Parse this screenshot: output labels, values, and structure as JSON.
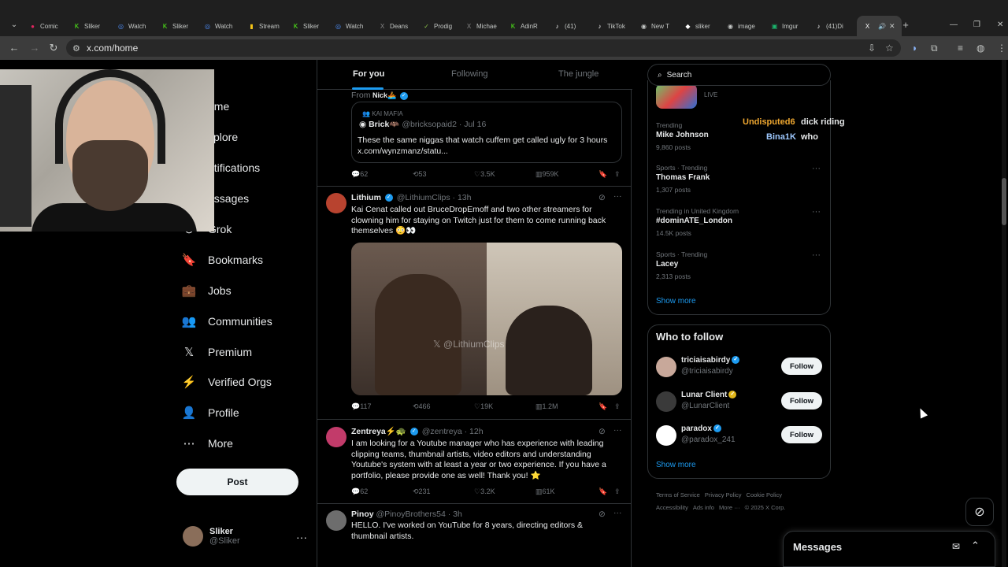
{
  "browser": {
    "tabs": [
      {
        "label": "Comic",
        "color": "#e0245e",
        "glyph": "●"
      },
      {
        "label": "Sliker",
        "color": "#53fc18",
        "glyph": "K"
      },
      {
        "label": "Watch",
        "color": "#4c8bf5",
        "glyph": "◎"
      },
      {
        "label": "Sliker",
        "color": "#53fc18",
        "glyph": "K"
      },
      {
        "label": "Watch",
        "color": "#4c8bf5",
        "glyph": "◎"
      },
      {
        "label": "Stream",
        "color": "#f5c518",
        "glyph": "▮"
      },
      {
        "label": "Sliker",
        "color": "#53fc18",
        "glyph": "K"
      },
      {
        "label": "Watch",
        "color": "#4c8bf5",
        "glyph": "◎"
      },
      {
        "label": "Deans",
        "color": "#888888",
        "glyph": "X"
      },
      {
        "label": "Prodig",
        "color": "#8bc34a",
        "glyph": "✓"
      },
      {
        "label": "Michae",
        "color": "#888888",
        "glyph": "X"
      },
      {
        "label": "AdinR",
        "color": "#53fc18",
        "glyph": "K"
      },
      {
        "label": "(41)",
        "color": "#ffffff",
        "glyph": "♪"
      },
      {
        "label": "TikTok",
        "color": "#ffffff",
        "glyph": "♪"
      },
      {
        "label": "New T",
        "color": "#c4c7c5",
        "glyph": "◉"
      },
      {
        "label": "sliker",
        "color": "#ffffff",
        "glyph": "◆"
      },
      {
        "label": "image",
        "color": "#c4c7c5",
        "glyph": "◉"
      },
      {
        "label": "Imgur",
        "color": "#1bb76e",
        "glyph": "▣"
      },
      {
        "label": "(41)Di",
        "color": "#ffffff",
        "glyph": "♪"
      },
      {
        "label": "",
        "color": "#ffffff",
        "glyph": "X"
      }
    ],
    "url": "x.com/home"
  },
  "nav": {
    "items": [
      {
        "label": "ome",
        "icon": "home-icon",
        "glyph": "⌂"
      },
      {
        "label": "xplore",
        "icon": "search-icon",
        "glyph": "⌕"
      },
      {
        "label": "otifications",
        "icon": "bell-icon",
        "glyph": "🔔"
      },
      {
        "label": "essages",
        "icon": "mail-icon",
        "glyph": "✉"
      },
      {
        "label": "Grok",
        "icon": "grok-icon",
        "glyph": "⊘"
      },
      {
        "label": "Bookmarks",
        "icon": "bookmark-icon",
        "glyph": "🔖"
      },
      {
        "label": "Jobs",
        "icon": "briefcase-icon",
        "glyph": "💼"
      },
      {
        "label": "Communities",
        "icon": "people-icon",
        "glyph": "👥"
      },
      {
        "label": "Premium",
        "icon": "x-logo-icon",
        "glyph": "𝕏"
      },
      {
        "label": "Verified Orgs",
        "icon": "lightning-icon",
        "glyph": "⚡"
      },
      {
        "label": "Profile",
        "icon": "person-icon",
        "glyph": "👤"
      },
      {
        "label": "More",
        "icon": "more-circle-icon",
        "glyph": "⋯"
      }
    ],
    "post_label": "Post",
    "account": {
      "name": "Sliker",
      "handle": "@Sliker"
    }
  },
  "feed": {
    "tabs": [
      "For you",
      "Following",
      "The jungle"
    ],
    "tweet1": {
      "from_label": "From",
      "from_name": "Nick🚣",
      "quote_context": "KAI MAFIA",
      "quote_name": "Brick🦇",
      "quote_handle": "@bricksopaid2 · Jul 16",
      "quote_text": "These the same niggas that watch cuffem get called ugly for 3 hours x.com/wynzmanz/statu...",
      "stats": {
        "replies": "62",
        "reposts": "53",
        "likes": "3.5K",
        "views": "959K"
      }
    },
    "tweet2": {
      "name": "Lithium",
      "handle": "@LithiumClips · 13h",
      "text": "Kai Cenat called out BruceDropEmoff and two other streamers for clowning him for staying on Twitch just for them to come running back themselves 😳👀",
      "watermark": "@LithiumClips",
      "stats": {
        "replies": "117",
        "reposts": "466",
        "likes": "19K",
        "views": "1.2M"
      }
    },
    "tweet3": {
      "name": "Zentreya⚡🐢",
      "handle": "@zentreya · 12h",
      "text": "I am looking for a Youtube manager who has experience with leading clipping teams, thumbnail artists, video editors and understanding Youtube's system with at least a year or two experience. If you have a portfolio, please provide one as well! Thank you! ⭐",
      "stats": {
        "replies": "62",
        "reposts": "231",
        "likes": "3.2K",
        "views": "61K"
      }
    },
    "tweet4": {
      "name": "Pinoy",
      "handle": "@PinoyBrothers54 · 3h",
      "text": "HELLO. I've worked on YouTube for 8 years, directing editors & thumbnail artists."
    }
  },
  "sidebar": {
    "search_placeholder": "Search",
    "live_label": "LIVE",
    "trends": [
      {
        "category": "Trending",
        "title": "Mike Johnson",
        "posts": "9,860 posts"
      },
      {
        "category": "Sports · Trending",
        "title": "Thomas Frank",
        "posts": "1,307 posts"
      },
      {
        "category": "Trending in United Kingdom",
        "title": "#dominATE_London",
        "posts": "14.5K posts"
      },
      {
        "category": "Sports · Trending",
        "title": "Lacey",
        "posts": "2,313 posts"
      }
    ],
    "show_more": "Show more",
    "chat_overlay": [
      {
        "user": "Undisputed6",
        "msg": "dick riding",
        "color": "#f0a830"
      },
      {
        "user": "Bina1K",
        "msg": "who",
        "color": "#9ec9ff"
      }
    ],
    "who_to_follow": {
      "title": "Who to follow",
      "accounts": [
        {
          "name": "triciaisabirdy",
          "handle": "@triciaisabirdy",
          "badge": "blue"
        },
        {
          "name": "Lunar Client",
          "handle": "@LunarClient",
          "badge": "gold"
        },
        {
          "name": "paradox",
          "handle": "@paradox_241",
          "badge": "blue"
        }
      ],
      "follow_label": "Follow",
      "show_more": "Show more"
    },
    "footer": [
      "Terms of Service",
      "Privacy Policy",
      "Cookie Policy",
      "Accessibility",
      "Ads info",
      "More ···",
      "© 2025 X Corp."
    ]
  },
  "messages": {
    "title": "Messages"
  }
}
